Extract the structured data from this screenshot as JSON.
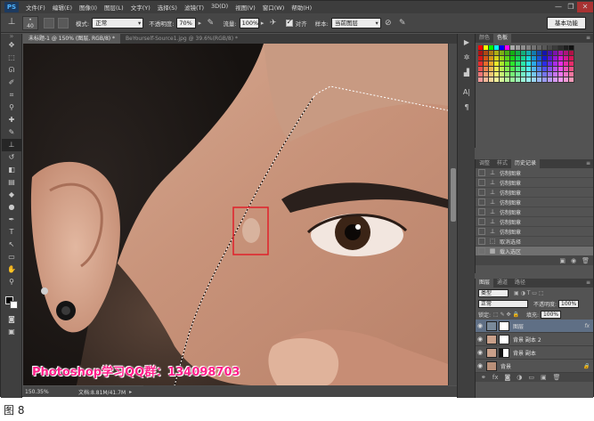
{
  "app": {
    "logo": "PS",
    "menu": [
      "文件(F)",
      "编辑(E)",
      "图像(I)",
      "图层(L)",
      "文字(Y)",
      "选择(S)",
      "滤镜(T)",
      "3D(D)",
      "视图(V)",
      "窗口(W)",
      "帮助(H)"
    ],
    "window_controls": [
      "—",
      "❐",
      "✕"
    ]
  },
  "options": {
    "brush_size": "40",
    "mode_label": "模式:",
    "mode_value": "正常",
    "opacity_label": "不透明度:",
    "opacity_value": "70%",
    "flow_label": "流量:",
    "flow_value": "100%",
    "aligned_label": "对齐",
    "sample_label": "样本:",
    "sample_value": "当前图层",
    "workspace": "基本功能"
  },
  "tabs": [
    {
      "label": "未标题-1 @ 150% (图层, RGB/8) *",
      "active": true
    },
    {
      "label": "BeYourself-Source1.jpg @ 39.6%(RGB/8) *",
      "active": false
    }
  ],
  "status": {
    "zoom": "150.35%",
    "doc": "文档:8.81M/41.7M"
  },
  "watermark": "Photoshop学习QQ群：134098703",
  "swatches_panel": {
    "tabs": [
      "颜色",
      "色板"
    ],
    "active": 1
  },
  "history_panel": {
    "tabs": [
      "调整",
      "样式",
      "历史记录"
    ],
    "active": 2,
    "items": [
      {
        "label": "仿制图章",
        "icon": "stamp-icon"
      },
      {
        "label": "仿制图章",
        "icon": "stamp-icon"
      },
      {
        "label": "仿制图章",
        "icon": "stamp-icon"
      },
      {
        "label": "仿制图章",
        "icon": "stamp-icon"
      },
      {
        "label": "仿制图章",
        "icon": "stamp-icon"
      },
      {
        "label": "仿制图章",
        "icon": "stamp-icon"
      },
      {
        "label": "仿制图章",
        "icon": "stamp-icon"
      },
      {
        "label": "取消选择",
        "icon": "deselect-icon"
      },
      {
        "label": "载入选区",
        "icon": "load-selection-icon",
        "active": true
      }
    ]
  },
  "layers_panel": {
    "tabs": [
      "图层",
      "通道",
      "路径"
    ],
    "active": 0,
    "filter_label": "类型",
    "blend_mode": "正常",
    "opacity_label": "不透明度:",
    "opacity_value": "100%",
    "lock_label": "锁定:",
    "fill_label": "填充:",
    "fill_value": "100%",
    "layers": [
      {
        "name": "图层",
        "fx": "fx",
        "active": true
      },
      {
        "name": "背景 副本 2",
        "fx": ""
      },
      {
        "name": "背景 副本",
        "fx": ""
      },
      {
        "name": "背景",
        "fx": ""
      }
    ]
  },
  "caption": "图 8",
  "colors": {
    "app_bg": "#535353",
    "selection_marker": "#e0202a",
    "watermark": "#ff1f8a"
  }
}
